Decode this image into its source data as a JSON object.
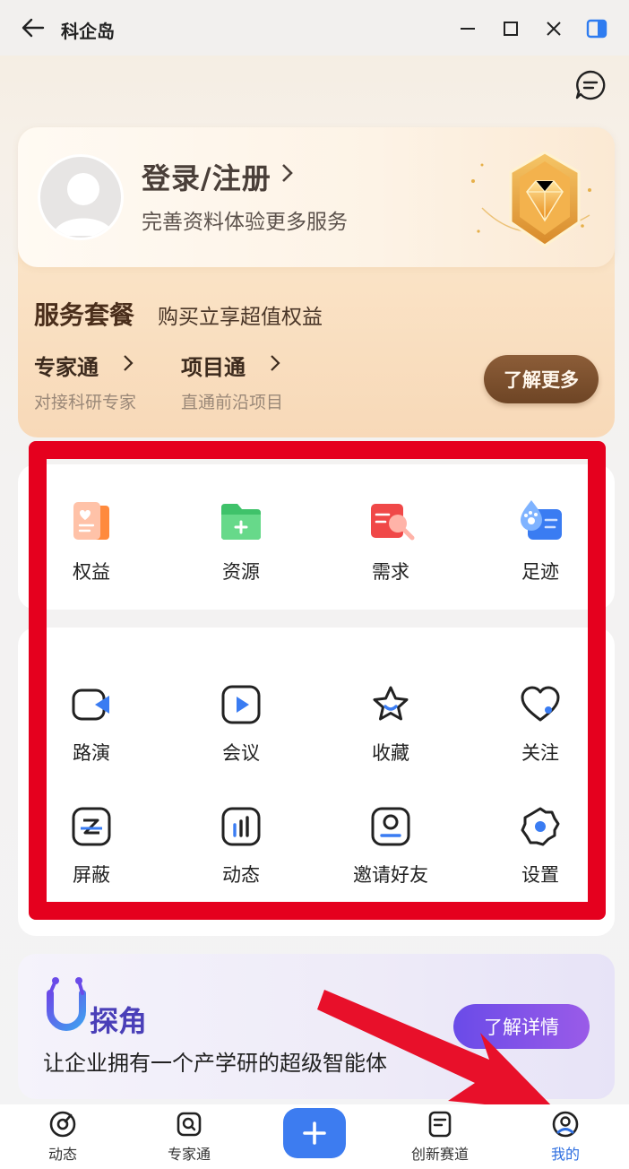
{
  "titlebar": {
    "title": "科企岛"
  },
  "profile": {
    "login_label": "登录/注册",
    "subtitle": "完善资料体验更多服务"
  },
  "service": {
    "title": "服务套餐",
    "subtitle": "购买立享超值权益",
    "items": [
      {
        "title": "专家通",
        "desc": "对接科研专家"
      },
      {
        "title": "项目通",
        "desc": "直通前沿项目"
      }
    ],
    "button_label": "了解更多"
  },
  "features_top": [
    {
      "label": "权益",
      "icon": "rights-icon"
    },
    {
      "label": "资源",
      "icon": "resource-folder-icon"
    },
    {
      "label": "需求",
      "icon": "demand-search-icon"
    },
    {
      "label": "足迹",
      "icon": "footprint-icon"
    }
  ],
  "features_bottom": [
    {
      "label": "路演",
      "icon": "roadshow-icon"
    },
    {
      "label": "会议",
      "icon": "meeting-play-icon"
    },
    {
      "label": "收藏",
      "icon": "star-icon"
    },
    {
      "label": "关注",
      "icon": "heart-icon"
    },
    {
      "label": "屏蔽",
      "icon": "block-icon"
    },
    {
      "label": "动态",
      "icon": "activity-chart-icon"
    },
    {
      "label": "邀请好友",
      "icon": "invite-friend-icon"
    },
    {
      "label": "设置",
      "icon": "settings-gear-icon"
    }
  ],
  "promo": {
    "name": "探角",
    "subtitle": "让企业拥有一个产学研的超级智能体",
    "button_label": "了解详情"
  },
  "bottom_nav": [
    {
      "label": "动态",
      "icon": "compass-icon"
    },
    {
      "label": "专家通",
      "icon": "expert-search-icon"
    },
    {
      "label": "创新赛道",
      "icon": "track-icon"
    },
    {
      "label": "我的",
      "icon": "profile-icon",
      "active": true
    }
  ],
  "colors": {
    "highlight_frame": "#e5001e",
    "accent_blue": "#3d7cf0",
    "brown_button": "#7a4e2c"
  }
}
